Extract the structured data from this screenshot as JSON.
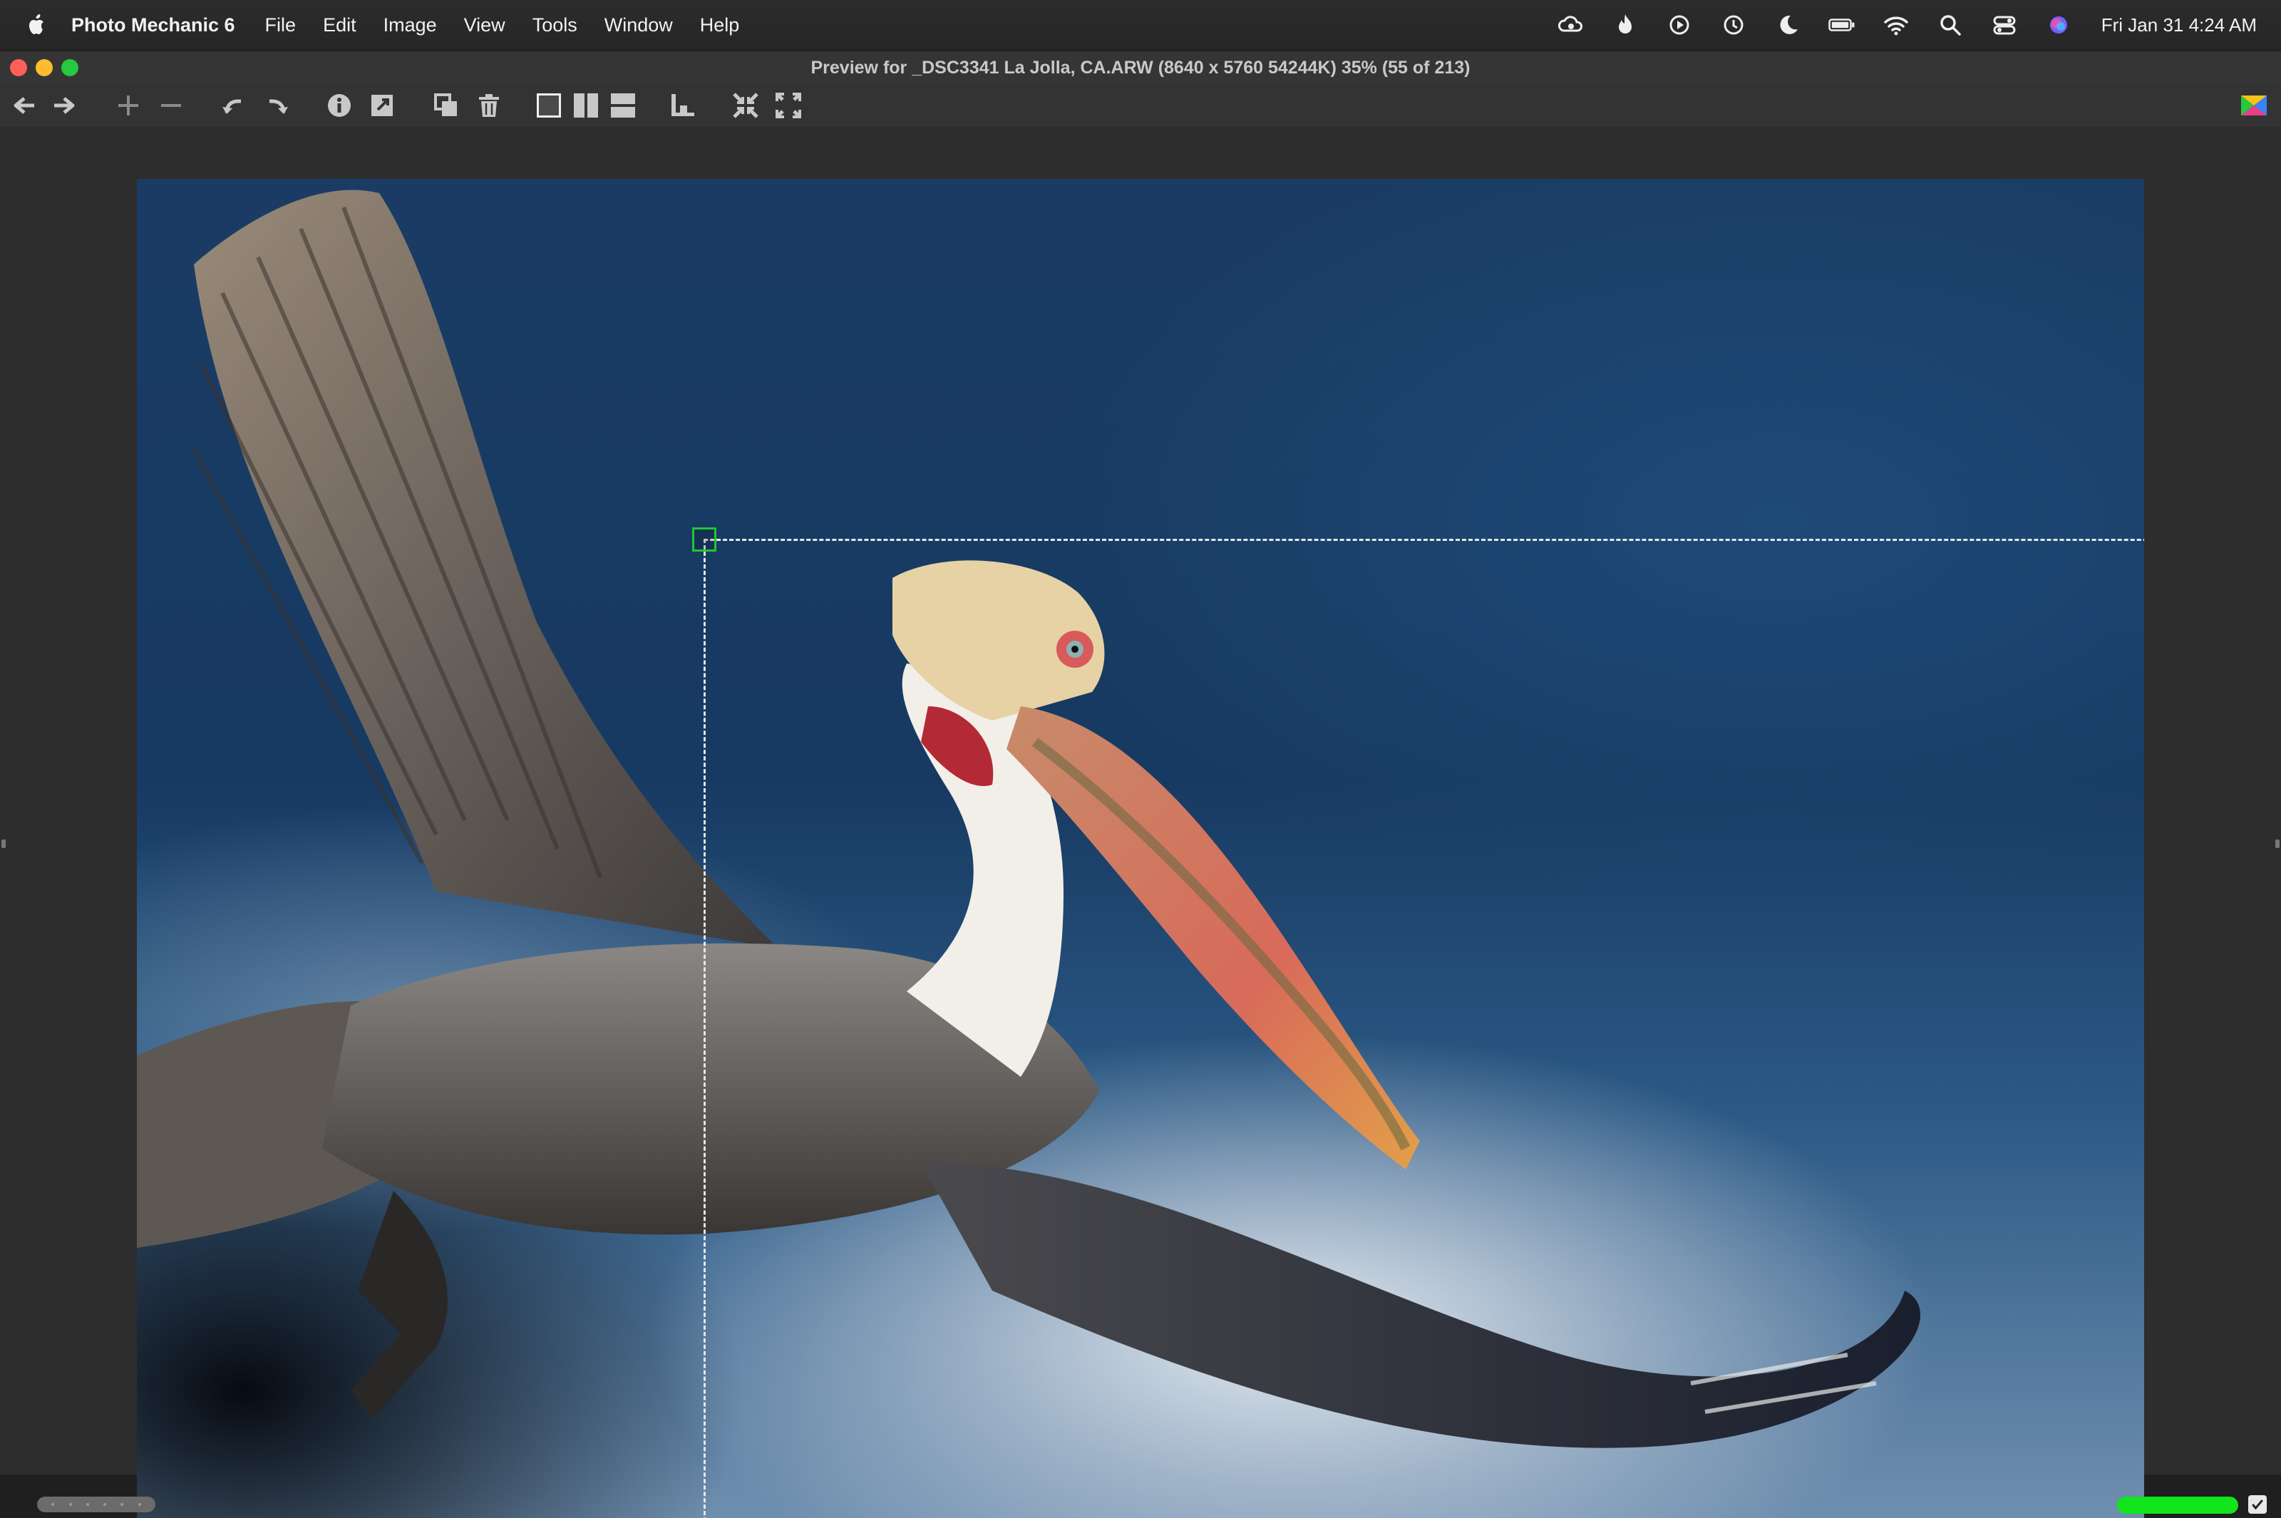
{
  "menubar": {
    "app_name": "Photo Mechanic 6",
    "items": [
      "File",
      "Edit",
      "Image",
      "View",
      "Tools",
      "Window",
      "Help"
    ],
    "clock": "Fri Jan 31  4:24 AM",
    "status_icons": [
      "cloud-sync-icon",
      "flame-icon",
      "play-circle-icon",
      "time-machine-icon",
      "moon-icon",
      "battery-icon",
      "wifi-icon",
      "search-icon",
      "control-center-icon",
      "siri-icon"
    ]
  },
  "window": {
    "title": "Preview for  _DSC3341 La Jolla, CA.ARW (8640 x 5760 54244K) 35% (55 of 213)"
  },
  "toolbar": {
    "buttons": [
      "back-arrow",
      "forward-arrow",
      "zoom-in",
      "zoom-out",
      "rotate-left",
      "rotate-right",
      "info",
      "edit-image",
      "copy",
      "delete",
      "single-view",
      "two-up-vertical",
      "two-up-horizontal",
      "align",
      "fit",
      "expand"
    ]
  },
  "preview": {
    "progress_fraction": 1.0,
    "crop_frame_visible": true,
    "checkbox_checked": true
  },
  "colors": {
    "crop_handle": "#21c732",
    "progress": "#12e51c",
    "close": "#ff5f57",
    "minimize": "#febc2e",
    "maximize": "#28c840"
  }
}
